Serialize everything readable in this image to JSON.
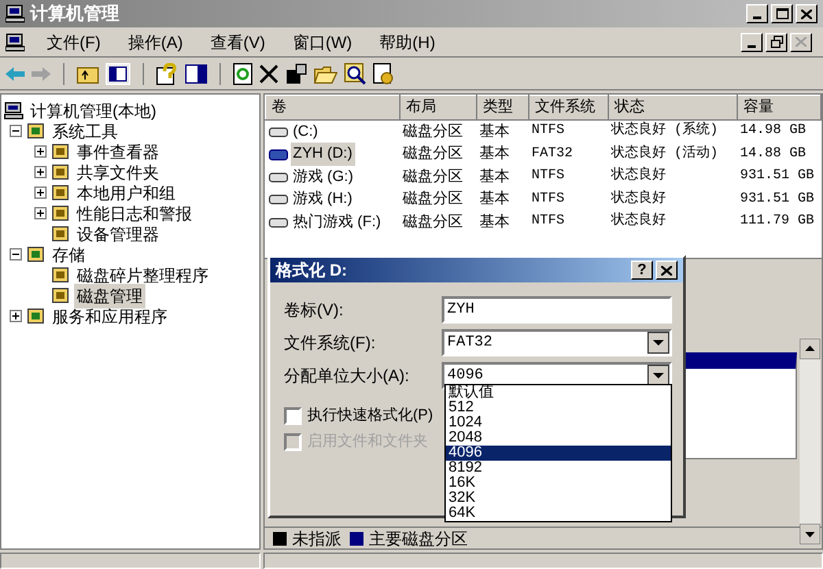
{
  "window": {
    "title": "计算机管理"
  },
  "menu": [
    {
      "label": "文件(F)"
    },
    {
      "label": "操作(A)"
    },
    {
      "label": "查看(V)"
    },
    {
      "label": "窗口(W)"
    },
    {
      "label": "帮助(H)"
    }
  ],
  "tree": [
    {
      "label": "计算机管理(本地)",
      "selected": false,
      "children": [
        {
          "label": "系统工具",
          "expanded": true,
          "selected": false,
          "children": [
            {
              "label": "事件查看器",
              "expanded": false,
              "selected": false
            },
            {
              "label": "共享文件夹",
              "expanded": false,
              "selected": false
            },
            {
              "label": "本地用户和组",
              "expanded": false,
              "selected": false
            },
            {
              "label": "性能日志和警报",
              "expanded": false,
              "selected": false
            },
            {
              "label": "设备管理器",
              "selected": false
            }
          ]
        },
        {
          "label": "存储",
          "expanded": true,
          "selected": false,
          "children": [
            {
              "label": "磁盘碎片整理程序",
              "selected": false
            },
            {
              "label": "磁盘管理",
              "selected": true
            }
          ]
        },
        {
          "label": "服务和应用程序",
          "expanded": false,
          "selected": false
        }
      ]
    }
  ],
  "volumes": {
    "columns": [
      "卷",
      "布局",
      "类型",
      "文件系统",
      "状态",
      "容量"
    ],
    "rows": [
      {
        "cells": [
          "(C:)",
          "磁盘分区",
          "基本",
          "NTFS",
          "状态良好 (系统)",
          "14.98 GB"
        ],
        "selected": false
      },
      {
        "cells": [
          "ZYH (D:)",
          "磁盘分区",
          "基本",
          "FAT32",
          "状态良好 (活动)",
          "14.88 GB"
        ],
        "selected": true
      },
      {
        "cells": [
          "游戏 (G:)",
          "磁盘分区",
          "基本",
          "NTFS",
          "状态良好",
          "931.51 GB"
        ],
        "selected": false
      },
      {
        "cells": [
          "游戏 (H:)",
          "磁盘分区",
          "基本",
          "NTFS",
          "状态良好",
          "931.51 GB"
        ],
        "selected": false
      },
      {
        "cells": [
          "热门游戏 (F:)",
          "磁盘分区",
          "基本",
          "NTFS",
          "状态良好",
          "111.79 GB"
        ],
        "selected": false
      }
    ]
  },
  "dialog": {
    "title": "格式化 D:",
    "help_button": "?",
    "fields": [
      {
        "kind": "text",
        "label": "卷标(V):",
        "value": "ZYH"
      },
      {
        "kind": "select",
        "label": "文件系统(F):",
        "value": "FAT32"
      },
      {
        "kind": "select",
        "label": "分配单位大小(A):",
        "value": "4096"
      }
    ],
    "checkboxes": [
      {
        "label": "执行快速格式化(P)",
        "checked": false,
        "disabled": false
      },
      {
        "label": "启用文件和文件夹",
        "checked": false,
        "disabled": true
      }
    ],
    "dropdown": [
      {
        "label": "默认值",
        "selected": false
      },
      {
        "label": "512",
        "selected": false
      },
      {
        "label": "1024",
        "selected": false
      },
      {
        "label": "2048",
        "selected": false
      },
      {
        "label": "4096",
        "selected": true
      },
      {
        "label": "8192",
        "selected": false
      },
      {
        "label": "16K",
        "selected": false
      },
      {
        "label": "32K",
        "selected": false
      },
      {
        "label": "64K",
        "selected": false
      }
    ]
  },
  "legend": [
    {
      "label": "未指派",
      "color": "#000000"
    },
    {
      "label": "主要磁盘分区",
      "color": "#000080"
    }
  ]
}
